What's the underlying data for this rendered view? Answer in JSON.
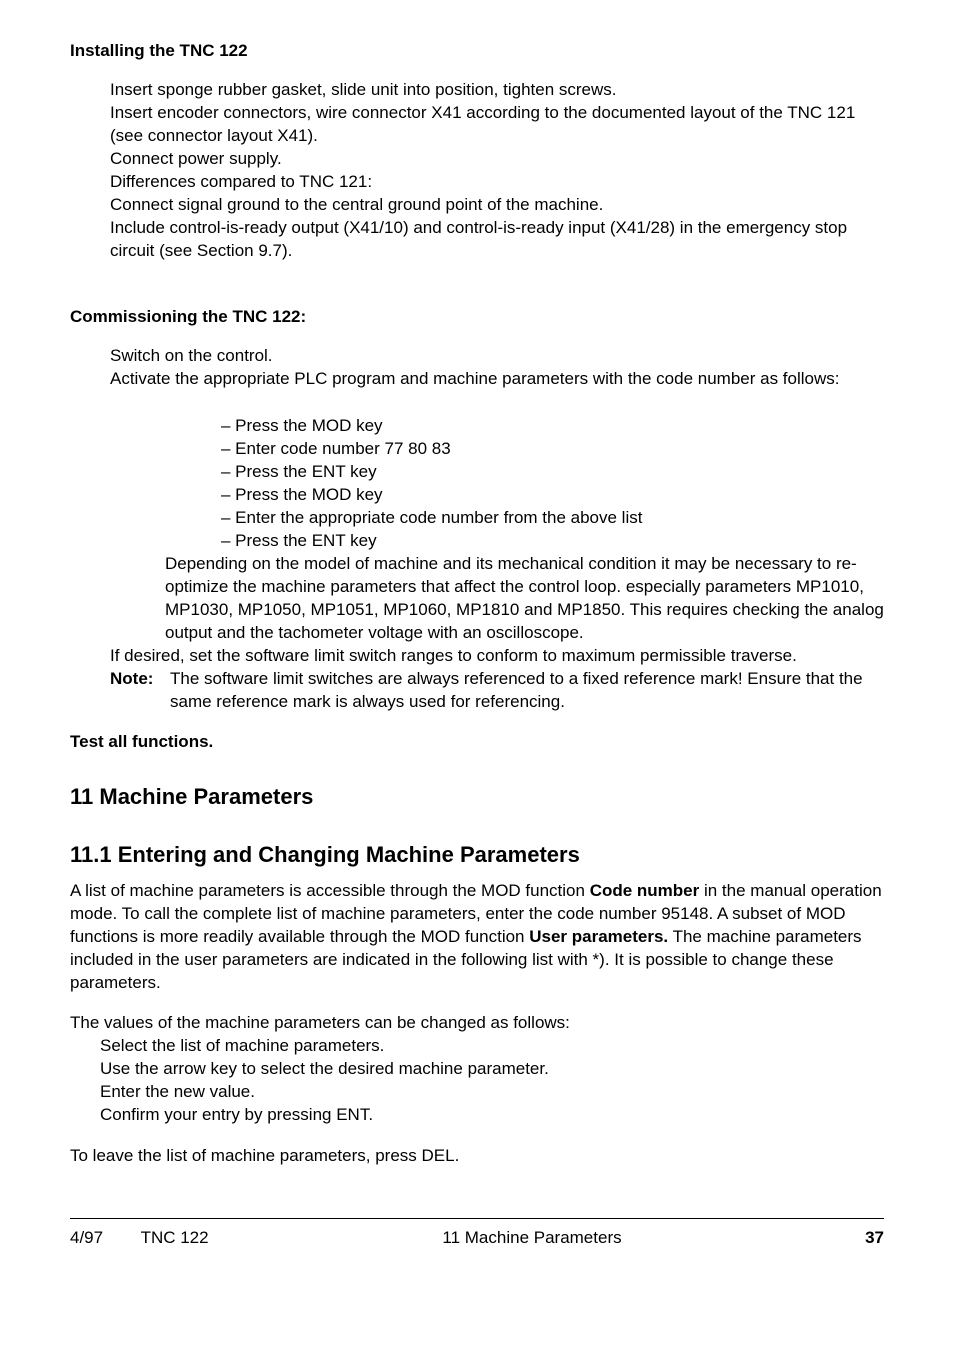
{
  "headings": {
    "installing": "Installing the TNC 122",
    "commissioning": "Commissioning the TNC 122:",
    "test": "Test all functions.",
    "sec11": "11  Machine Parameters",
    "sec11_1": "11.1  Entering and Changing Machine Parameters"
  },
  "installing": {
    "l1": "Insert sponge rubber gasket, slide unit into position, tighten screws.",
    "l2": "Insert encoder connectors, wire connector X41 according to the documented layout of the TNC 121 (see connector layout X41).",
    "l3": "Connect power supply.",
    "l4": "Differences compared to TNC 121:",
    "l5": "Connect signal ground to the central ground point of the machine.",
    "l6": "Include control-is-ready output (X41/10) and control-is-ready input (X41/28) in the emergency stop circuit (see Section 9.7)."
  },
  "commissioning": {
    "l1": "Switch on the control.",
    "l2": "Activate the appropriate PLC program and machine parameters with the code number as follows:",
    "steps": {
      "s1": "– Press the MOD key",
      "s2": "– Enter code number 77 80 83",
      "s3": "– Press the ENT key",
      "s4": "– Press the MOD key",
      "s5": "– Enter the appropriate code number from the above list",
      "s6": "– Press the ENT key"
    },
    "p1": "Depending on the model of machine and its mechanical condition it may be necessary to re-optimize the machine parameters that affect the control loop. especially parameters MP1010, MP1030, MP1050, MP1051, MP1060, MP1810 and MP1850. This requires checking the analog output and the tachometer voltage with an oscilloscope.",
    "p2": "If desired, set the software limit switch ranges to conform to maximum permissible traverse.",
    "note_label": "Note:",
    "note_text": "The software limit switches are always referenced to a fixed reference mark! Ensure that the same reference mark is always used for referencing."
  },
  "sec11_1": {
    "p1a": "A list of machine parameters is accessible through the MOD function ",
    "p1b": "Code number",
    "p1c": " in the manual operation mode. To call the complete list of machine parameters, enter the code number 95148. A subset of MOD functions is more readily available through the MOD function ",
    "p1d": "User parameters.",
    "p1e": " The machine parameters included in the user parameters are indicated in the following list with *). It is possible to change these parameters.",
    "p2": "The values of the machine parameters can be changed as follows:",
    "b1": "Select the list of machine parameters.",
    "b2": "Use the arrow key to select the desired machine parameter.",
    "b3": "Enter the new value.",
    "b4": "Confirm your entry by pressing ENT.",
    "p3": "To leave the list of machine parameters, press DEL."
  },
  "footer": {
    "left": "4/97        TNC 122",
    "center": "11  Machine Parameters",
    "right": "37"
  }
}
